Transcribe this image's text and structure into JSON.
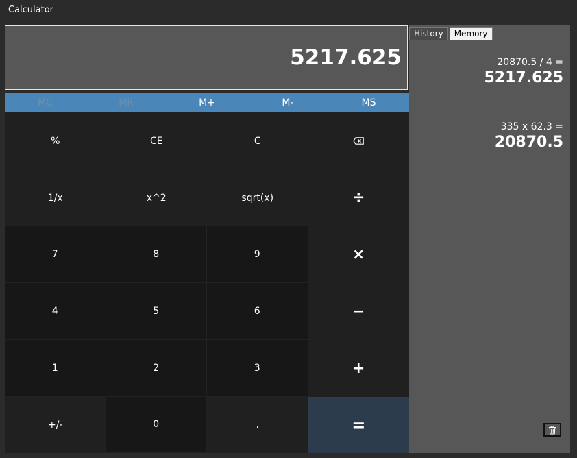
{
  "window": {
    "title": "Calculator"
  },
  "display": {
    "value": "5217.625"
  },
  "memory": [
    {
      "label": "MC",
      "enabled": false
    },
    {
      "label": "MR",
      "enabled": false
    },
    {
      "label": "M+",
      "enabled": true
    },
    {
      "label": "M-",
      "enabled": true
    },
    {
      "label": "MS",
      "enabled": true
    }
  ],
  "keys": {
    "percent": "%",
    "ce": "CE",
    "c": "C",
    "reciprocal": "1/x",
    "square": "x^2",
    "sqrt": "sqrt(x)",
    "divide": "÷",
    "seven": "7",
    "eight": "8",
    "nine": "9",
    "multiply": "×",
    "four": "4",
    "five": "5",
    "six": "6",
    "minus": "−",
    "one": "1",
    "two": "2",
    "three": "3",
    "plus": "+",
    "negate": "+/-",
    "zero": "0",
    "decimal": ".",
    "equals": "="
  },
  "side_panel": {
    "tabs": [
      "History",
      "Memory"
    ],
    "active_tab": "History",
    "history": [
      {
        "expression": "20870.5 / 4 =",
        "result": "5217.625"
      },
      {
        "expression": "335 x 62.3 =",
        "result": "20870.5"
      }
    ]
  }
}
